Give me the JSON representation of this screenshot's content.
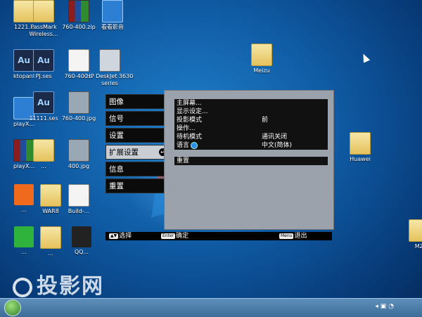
{
  "desktop": {
    "icons": [
      {
        "label": "1221...",
        "glyph": "g-folder"
      },
      {
        "label": "PassMark Wireless...",
        "glyph": "g-folder"
      },
      {
        "label": "760-400.zip",
        "glyph": "g-zip"
      },
      {
        "label": "看看影音",
        "glyph": "g-blue"
      },
      {
        "label": "ktopanl",
        "glyph": "g-au"
      },
      {
        "label": "PJ.ses",
        "glyph": "g-au"
      },
      {
        "label": "760-400...",
        "glyph": "g-file"
      },
      {
        "label": "HP DeskJet 3630 series",
        "glyph": "g-printer"
      },
      {
        "label": "Meizu",
        "glyph": "g-folder"
      },
      {
        "label": "playX...",
        "glyph": "g-blue"
      },
      {
        "label": "11111.ses",
        "glyph": "g-au"
      },
      {
        "label": "760-400.jpg",
        "glyph": "g-photo"
      },
      {
        "label": "playX...",
        "glyph": "g-zip"
      },
      {
        "label": "...",
        "glyph": "g-folder"
      },
      {
        "label": "400.jpg",
        "glyph": "g-photo"
      },
      {
        "label": "Huawei",
        "glyph": "g-folder"
      },
      {
        "label": "...",
        "glyph": "g-orange"
      },
      {
        "label": "WAR8",
        "glyph": "g-folder"
      },
      {
        "label": "Build-...",
        "glyph": "g-file"
      },
      {
        "label": "...",
        "glyph": "g-green"
      },
      {
        "label": "...",
        "glyph": "g-folder"
      },
      {
        "label": "QQ...",
        "glyph": "g-qq"
      },
      {
        "label": "MZ",
        "glyph": "g-folder"
      }
    ]
  },
  "projector_menu": {
    "left_items": [
      {
        "label": "图像"
      },
      {
        "label": "信号"
      },
      {
        "label": "设置"
      },
      {
        "label": "扩展设置",
        "selected": true
      },
      {
        "label": "信息"
      },
      {
        "label": "重置"
      }
    ],
    "submenu_rows": [
      {
        "label": "主屏幕...",
        "value": ""
      },
      {
        "label": "显示设定...",
        "value": ""
      },
      {
        "label": "投影模式",
        "value": "前"
      },
      {
        "label": "操作...",
        "value": ""
      },
      {
        "label": "待机模式",
        "value": "通讯关闭"
      },
      {
        "label": "语言",
        "value": "中文(简体)"
      },
      {
        "label": "重置",
        "value": ""
      }
    ],
    "bottom_hints": {
      "select_key": "▲▼",
      "select_label": "选择",
      "enter_key": "Enter",
      "enter_label": "确定",
      "menu_key": "Menu",
      "menu_label": "退出"
    }
  },
  "watermark": {
    "text": "投影网"
  },
  "colors": {
    "desktop_blue": "#0f5aa3",
    "menu_bg": "#0b0b0b",
    "panel_bg": "#9ba2ab",
    "selected_bg": "#c9ced4"
  }
}
